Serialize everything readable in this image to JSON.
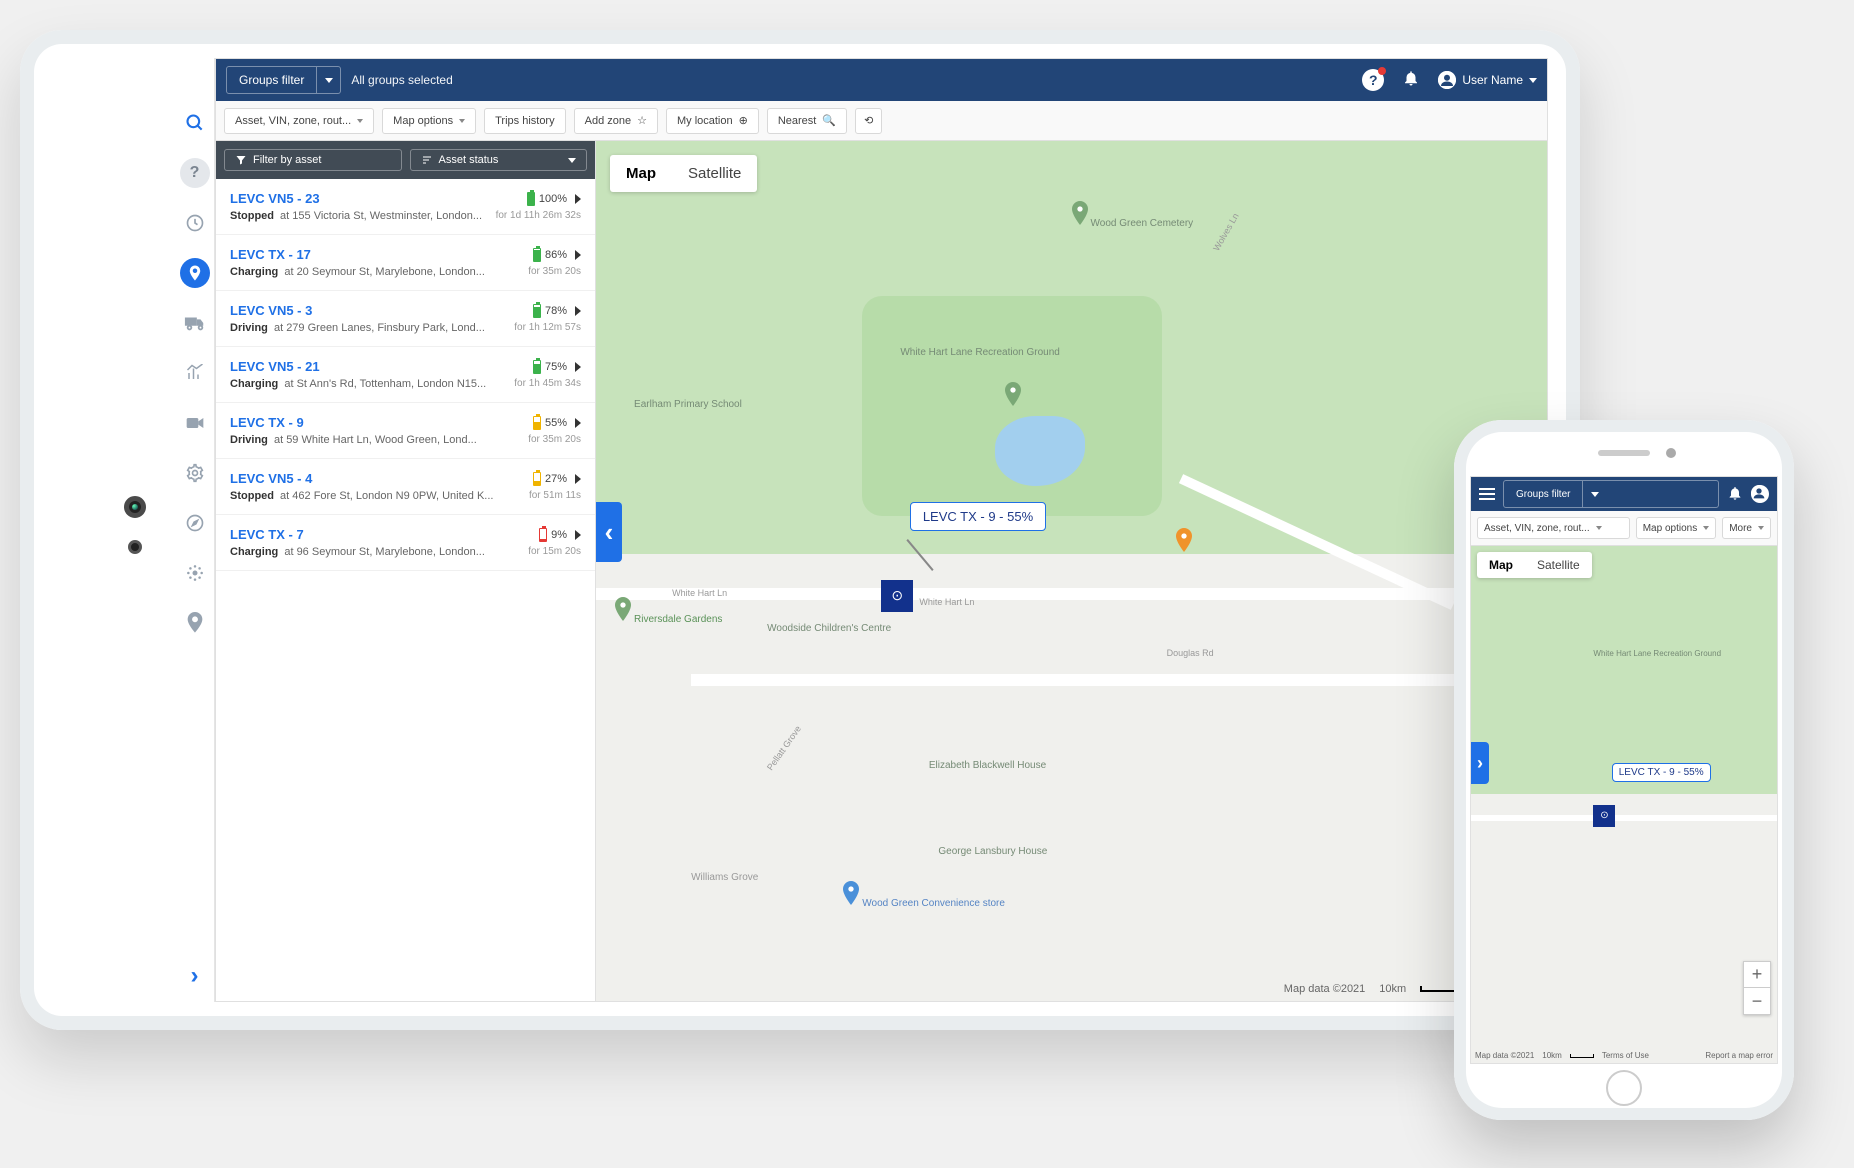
{
  "header": {
    "groups_filter_label": "Groups filter",
    "groups_selected_text": "All groups selected",
    "user_name": "User Name"
  },
  "toolbar": {
    "asset_search_placeholder": "Asset, VIN, zone, rout...",
    "map_options": "Map options",
    "trips_history": "Trips history",
    "add_zone": "Add zone",
    "my_location": "My location",
    "nearest": "Nearest"
  },
  "sidebar": {
    "filter_by_asset": "Filter by asset",
    "asset_status": "Asset status",
    "assets": [
      {
        "name": "LEVC VN5 - 23",
        "status": "Stopped",
        "at": "at",
        "addr": "155 Victoria St, Westminster, London...",
        "batt": "100%",
        "batt_pct": 100,
        "batt_color": "green",
        "dur": "for 1d 11h 26m 32s"
      },
      {
        "name": "LEVC TX - 17",
        "status": "Charging",
        "at": "at",
        "addr": "20 Seymour St, Marylebone, London...",
        "batt": "86%",
        "batt_pct": 86,
        "batt_color": "green",
        "dur": "for 35m 20s"
      },
      {
        "name": "LEVC VN5 - 3",
        "status": "Driving",
        "at": "at",
        "addr": "279 Green Lanes, Finsbury Park, Lond...",
        "batt": "78%",
        "batt_pct": 78,
        "batt_color": "green",
        "dur": "for 1h 12m 57s"
      },
      {
        "name": "LEVC VN5 - 21",
        "status": "Charging",
        "at": "at",
        "addr": "St Ann's Rd, Tottenham, London N15...",
        "batt": "75%",
        "batt_pct": 75,
        "batt_color": "green",
        "dur": "for 1h 45m 34s"
      },
      {
        "name": "LEVC TX - 9",
        "status": "Driving",
        "at": "at",
        "addr": "59 White Hart Ln, Wood Green, Lond...",
        "batt": "55%",
        "batt_pct": 55,
        "batt_color": "yellow",
        "dur": "for 35m 20s"
      },
      {
        "name": "LEVC VN5 - 4",
        "status": "Stopped",
        "at": "at",
        "addr": "462 Fore St, London N9 0PW, United K...",
        "batt": "27%",
        "batt_pct": 27,
        "batt_color": "yellow",
        "dur": "for 51m 11s"
      },
      {
        "name": "LEVC TX - 7",
        "status": "Charging",
        "at": "at",
        "addr": "96 Seymour St, Marylebone, London...",
        "batt": "9%",
        "batt_pct": 9,
        "batt_color": "red",
        "dur": "for 15m 20s"
      }
    ]
  },
  "map": {
    "view_map": "Map",
    "view_satellite": "Satellite",
    "marker_tooltip": "LEVC TX - 9 - 55%",
    "collapse": "‹",
    "attrib_data": "Map data ©2021",
    "attrib_scale": "10km",
    "attrib_terms": "Terms of Use",
    "labels": {
      "park": "White Hart Lane\nRecreation Ground",
      "cemetery": "Wood Green Cemetery",
      "school": "Earlham Primary School",
      "gardens": "Riversdale Gardens",
      "childrens": "Woodside\nChildren's Centre",
      "blackwell": "Elizabeth\nBlackwell House",
      "lansbury": "George Lansbury House",
      "convenience": "Wood Green\nConvenience store",
      "grove": "Williams Grove",
      "whitehart": "White Hart Ln",
      "douglas": "Douglas Rd",
      "wolves": "Wolves Ln",
      "pellatt": "Pellatt Grove"
    }
  },
  "phone": {
    "groups_filter_label": "Groups filter",
    "asset_search_placeholder": "Asset, VIN, zone, rout...",
    "map_options": "Map options",
    "more": "More",
    "view_map": "Map",
    "view_satellite": "Satellite",
    "marker_tooltip": "LEVC TX - 9 - 55%",
    "collapse": "›",
    "attrib_data": "Map data ©2021",
    "attrib_scale": "10km",
    "attrib_terms": "Terms of Use",
    "attrib_report": "Report a map error",
    "park_label": "White Hart Lane\nRecreation Ground"
  },
  "icons": {
    "help": "?",
    "bell": "🔔",
    "star": "☆",
    "target": "◎",
    "search_glass": "🔍",
    "refresh": "↻",
    "funnel": "▾"
  }
}
